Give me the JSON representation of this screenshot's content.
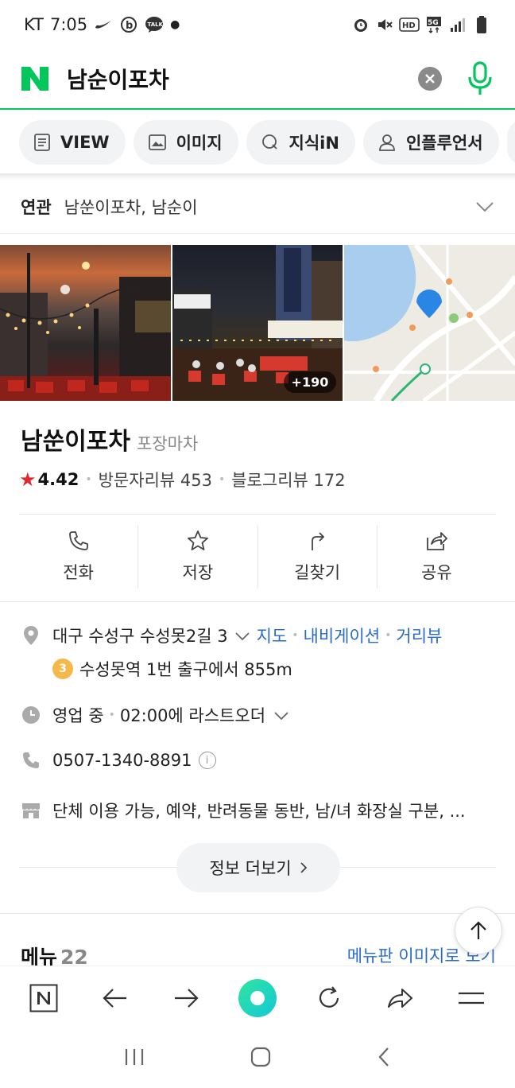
{
  "status_bar": {
    "carrier": "KT",
    "time": "7:05",
    "icons": [
      "nike-icon",
      "b-icon",
      "talk-icon",
      "dot-icon",
      "alarm-icon",
      "mute-icon",
      "hd-icon",
      "5g-icon",
      "signal-icon",
      "battery-icon"
    ],
    "talk_text": "TALK",
    "hd_text": "HD",
    "fiveg_text": "5G"
  },
  "search": {
    "query": "남순이포차",
    "brand_color": "#03c75a"
  },
  "tabs": [
    {
      "label": "VIEW",
      "icon": "document-icon"
    },
    {
      "label": "이미지",
      "icon": "image-icon"
    },
    {
      "label": "지식iN",
      "icon": "q-icon"
    },
    {
      "label": "인플루언서",
      "icon": "person-icon"
    }
  ],
  "related": {
    "label": "연관",
    "value": "남쑨이포차, 남순이"
  },
  "gallery": {
    "more_count": "+190"
  },
  "place": {
    "name": "남쑨이포차",
    "category": "포장마차",
    "rating": "4.42",
    "visitor_reviews": "방문자리뷰 453",
    "blog_reviews": "블로그리뷰 172"
  },
  "actions": [
    {
      "label": "전화",
      "icon": "phone-icon"
    },
    {
      "label": "저장",
      "icon": "star-icon"
    },
    {
      "label": "길찾기",
      "icon": "directions-icon"
    },
    {
      "label": "공유",
      "icon": "share-icon"
    }
  ],
  "address": {
    "text": "대구 수성구 수성못2길 3",
    "links": [
      "지도",
      "내비게이션",
      "거리뷰"
    ],
    "subway_line": "3",
    "subway_text": "수성못역 1번 출구에서 855m",
    "subway_color": "#f5b84a"
  },
  "hours": {
    "status": "영업 중",
    "detail": "02:00에 라스트오더"
  },
  "phone": {
    "number": "0507-1340-8891",
    "info_glyph": "i"
  },
  "amenities": {
    "text": "단체 이용 가능, 예약, 반려동물 동반, 남/녀 화장실 구분, ..."
  },
  "more_button": {
    "label": "정보 더보기"
  },
  "menu_section": {
    "title": "메뉴",
    "count": "22",
    "link": "메뉴판 이미지로 보기"
  },
  "link_color": "#2a6bc9"
}
